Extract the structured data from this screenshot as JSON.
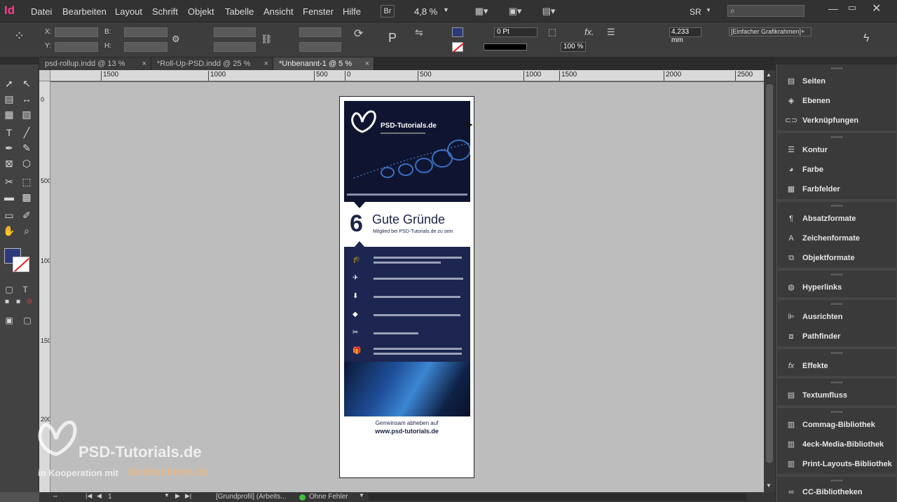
{
  "app": {
    "logo": "Id",
    "colors": {
      "accent": "#ff3c8e",
      "navy": "#1c2447"
    }
  },
  "menu": [
    "Datei",
    "Bearbeiten",
    "Layout",
    "Schrift",
    "Objekt",
    "Tabelle",
    "Ansicht",
    "Fenster",
    "Hilfe"
  ],
  "menubar": {
    "bridge": "Br",
    "zoom": "4,8 %",
    "workspace": "SR"
  },
  "control": {
    "x_label": "X:",
    "y_label": "Y:",
    "w_label": "B:",
    "h_label": "H:",
    "stroke": "0 Pt",
    "size": "4,233 mm",
    "opacity": "100 %",
    "frame_style": "[Einfacher Grafikrahmen]+"
  },
  "tabs": [
    {
      "label": "psd-rollup.indd @ 13 %",
      "close": "×"
    },
    {
      "label": "*Roll-Up-PSD.indd @ 25 %",
      "close": "×"
    },
    {
      "label": "*Unbenannt-1 @ 5 %",
      "close": "×"
    }
  ],
  "ruler": {
    "top": [
      "1500",
      "1000",
      "500",
      "0",
      "500",
      "1000",
      "1500",
      "2000",
      "2500"
    ],
    "left": [
      "0",
      "500",
      "1000",
      "1500",
      "2000"
    ]
  },
  "document": {
    "brand": "PSD-Tutorials.de",
    "headline_number": "6",
    "headline": "Gute Gründe",
    "subline": "Mitglied bei PSD-Tutorials.de zu sein",
    "list_icons": [
      "🎓",
      "✈",
      "⬇",
      "◆",
      "✂",
      "🎁"
    ],
    "footer_line1": "Gemeinsam abheben auf",
    "footer_line2": "www.psd-tutorials.de"
  },
  "watermark": {
    "brand": "PSD-Tutorials.de",
    "coop": "in Kooperation mit",
    "partner": "diedruckerei.de"
  },
  "status": {
    "page": "1",
    "profile": "[Grundprofil] (Arbeits...",
    "preflight": "Ohne Fehler"
  },
  "panels": [
    {
      "group": [
        {
          "label": "Seiten",
          "icon": "page-icon"
        },
        {
          "label": "Ebenen",
          "icon": "layers-icon"
        },
        {
          "label": "Verknüpfungen",
          "icon": "link-icon"
        }
      ]
    },
    {
      "group": [
        {
          "label": "Kontur",
          "icon": "stroke-icon"
        },
        {
          "label": "Farbe",
          "icon": "palette-icon"
        },
        {
          "label": "Farbfelder",
          "icon": "swatches-icon"
        }
      ]
    },
    {
      "group": [
        {
          "label": "Absatzformate",
          "icon": "paragraph-style-icon"
        },
        {
          "label": "Zeichenformate",
          "icon": "character-style-icon"
        },
        {
          "label": "Objektformate",
          "icon": "object-style-icon"
        }
      ]
    },
    {
      "group": [
        {
          "label": "Hyperlinks",
          "icon": "hyperlink-icon"
        }
      ]
    },
    {
      "group": [
        {
          "label": "Ausrichten",
          "icon": "align-icon"
        },
        {
          "label": "Pathfinder",
          "icon": "pathfinder-icon"
        }
      ]
    },
    {
      "group": [
        {
          "label": "Effekte",
          "icon": "fx-icon"
        }
      ]
    },
    {
      "group": [
        {
          "label": "Textumfluss",
          "icon": "text-wrap-icon"
        }
      ]
    },
    {
      "group": [
        {
          "label": "Commag-Bibliothek",
          "icon": "library-icon"
        },
        {
          "label": "4eck-Media-Bibliothek",
          "icon": "library-icon"
        },
        {
          "label": "Print-Layouts-Bibliothek",
          "icon": "library-icon"
        }
      ]
    },
    {
      "group": [
        {
          "label": "CC-Bibliotheken",
          "icon": "cc-library-icon"
        }
      ]
    }
  ]
}
